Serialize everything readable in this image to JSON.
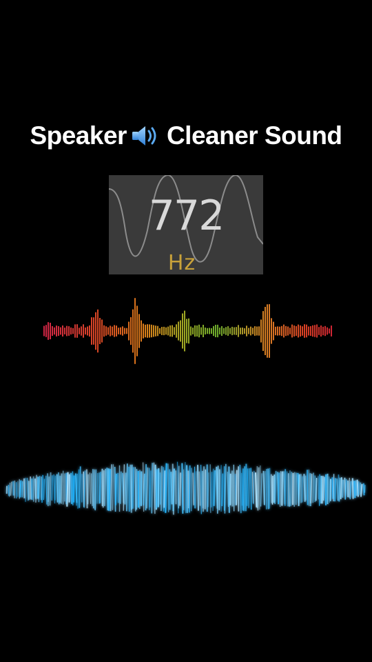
{
  "title": {
    "left": "Speaker",
    "icon": "speaker-volume-icon",
    "right": "Cleaner Sound"
  },
  "frequency": {
    "value": "772",
    "unit": "Hz"
  },
  "colors": {
    "background": "#000000",
    "title": "#ffffff",
    "panel": "#3a3a3a",
    "value": "#d9d9d9",
    "unit": "#c9a23a",
    "blue_wave": "#4fb8ff"
  }
}
